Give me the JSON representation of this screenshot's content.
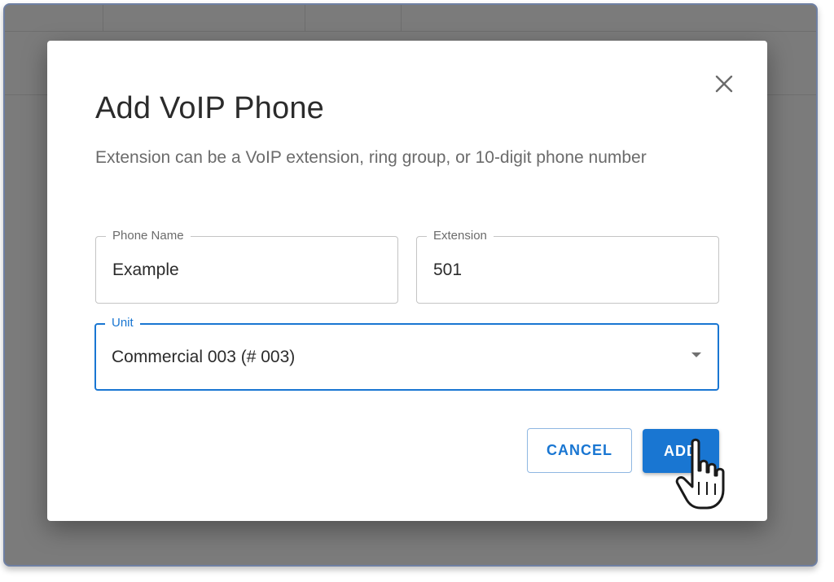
{
  "dialog": {
    "title": "Add VoIP Phone",
    "subtitle": "Extension can be a VoIP extension, ring group, or 10-digit phone number",
    "close_icon": "close-icon"
  },
  "fields": {
    "phone_name": {
      "label": "Phone Name",
      "value": "Example"
    },
    "extension": {
      "label": "Extension",
      "value": "501"
    },
    "unit": {
      "label": "Unit",
      "value": "Commercial 003 (# 003)"
    }
  },
  "actions": {
    "cancel_label": "CANCEL",
    "add_label": "ADD"
  },
  "colors": {
    "accent": "#1976d2",
    "backdrop": "#7b7b7b",
    "frame_border": "#6f80a3"
  },
  "icons": {
    "close": "close-icon",
    "dropdown": "chevron-down-icon",
    "cursor": "hand-pointer-cursor-icon"
  }
}
